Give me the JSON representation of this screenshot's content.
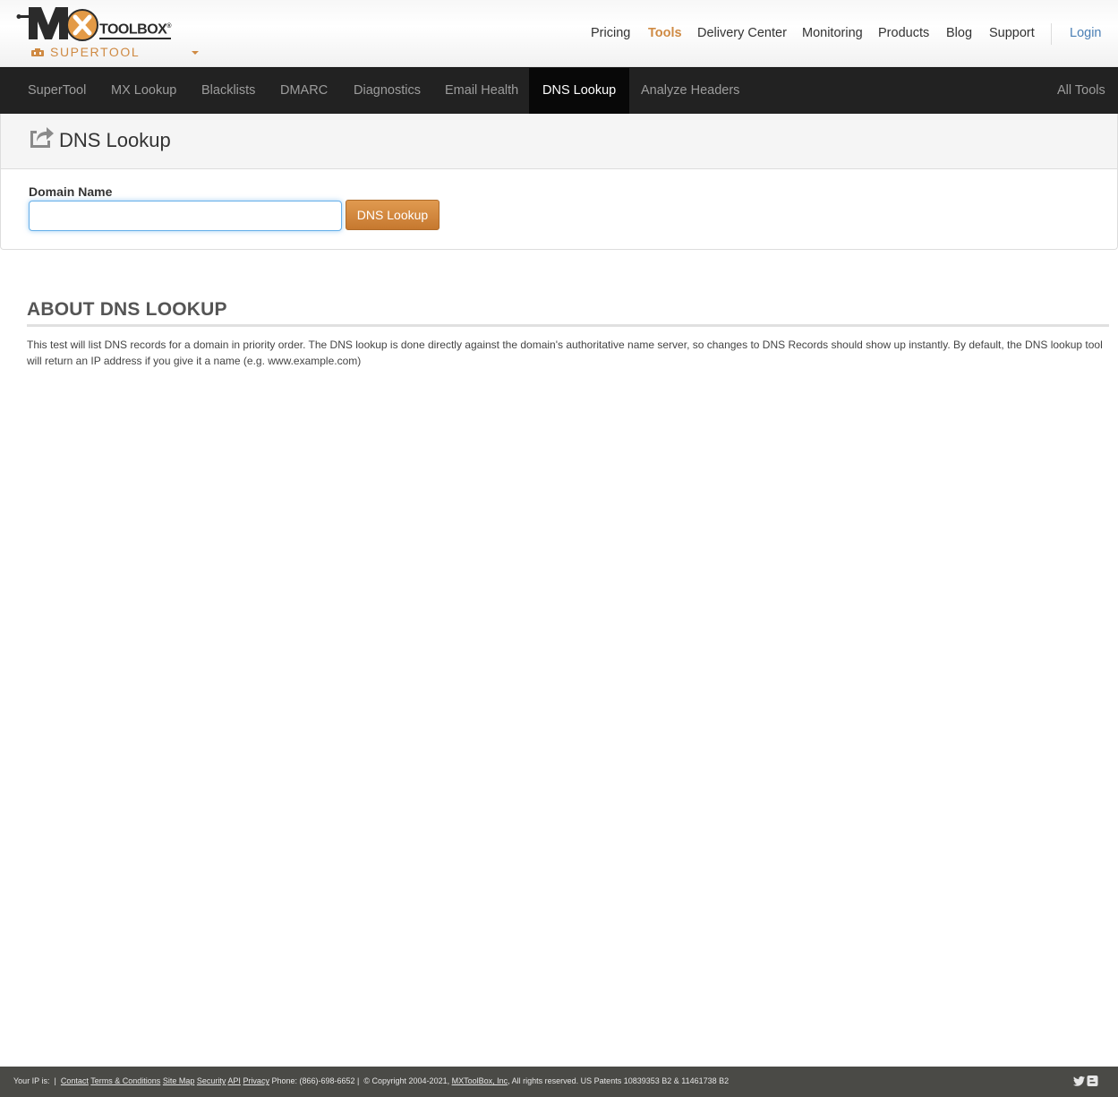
{
  "brand": {
    "logo_mx": "MX",
    "logo_toolbox": "TOOLBOX",
    "logo_reg": "®",
    "supertool_label": "SUPERTOOL"
  },
  "topnav": {
    "items": [
      "Pricing",
      "Tools",
      "Delivery Center",
      "Monitoring",
      "Products",
      "Blog",
      "Support"
    ],
    "active": "Tools",
    "login": "Login"
  },
  "toolsbar": {
    "items": [
      "SuperTool",
      "MX Lookup",
      "Blacklists",
      "DMARC",
      "Diagnostics",
      "Email Health",
      "DNS Lookup",
      "Analyze Headers"
    ],
    "active": "DNS Lookup",
    "all_tools": "All Tools"
  },
  "panel": {
    "title": "DNS Lookup",
    "field_label": "Domain Name",
    "input_value": "",
    "button_label": "DNS Lookup"
  },
  "about": {
    "title": "ABOUT DNS LOOKUP",
    "text": "This test will list DNS records for a domain in priority order. The DNS lookup is done directly against the domain's authoritative name server, so changes to DNS Records should show up instantly. By default, the DNS lookup tool will return an IP address if you give it a name (e.g. www.example.com)"
  },
  "footer": {
    "ip_label": "Your IP is:",
    "pipe": "|",
    "links": [
      "Contact",
      "Terms & Conditions",
      "Site Map",
      "Security",
      "API",
      "Privacy"
    ],
    "phone": "Phone: (866)-698-6652 |",
    "copyright_prefix": "© Copyright 2004-2021,",
    "company_link": "MXToolBox, Inc",
    "copyright_suffix": ", All rights reserved. US Patents 10839353 B2 & 11461738 B2"
  },
  "colors": {
    "accent": "#cf8a43",
    "link": "#4a7fb5",
    "toolsbar_bg": "#222222",
    "footer_bg": "#4a4a46"
  }
}
